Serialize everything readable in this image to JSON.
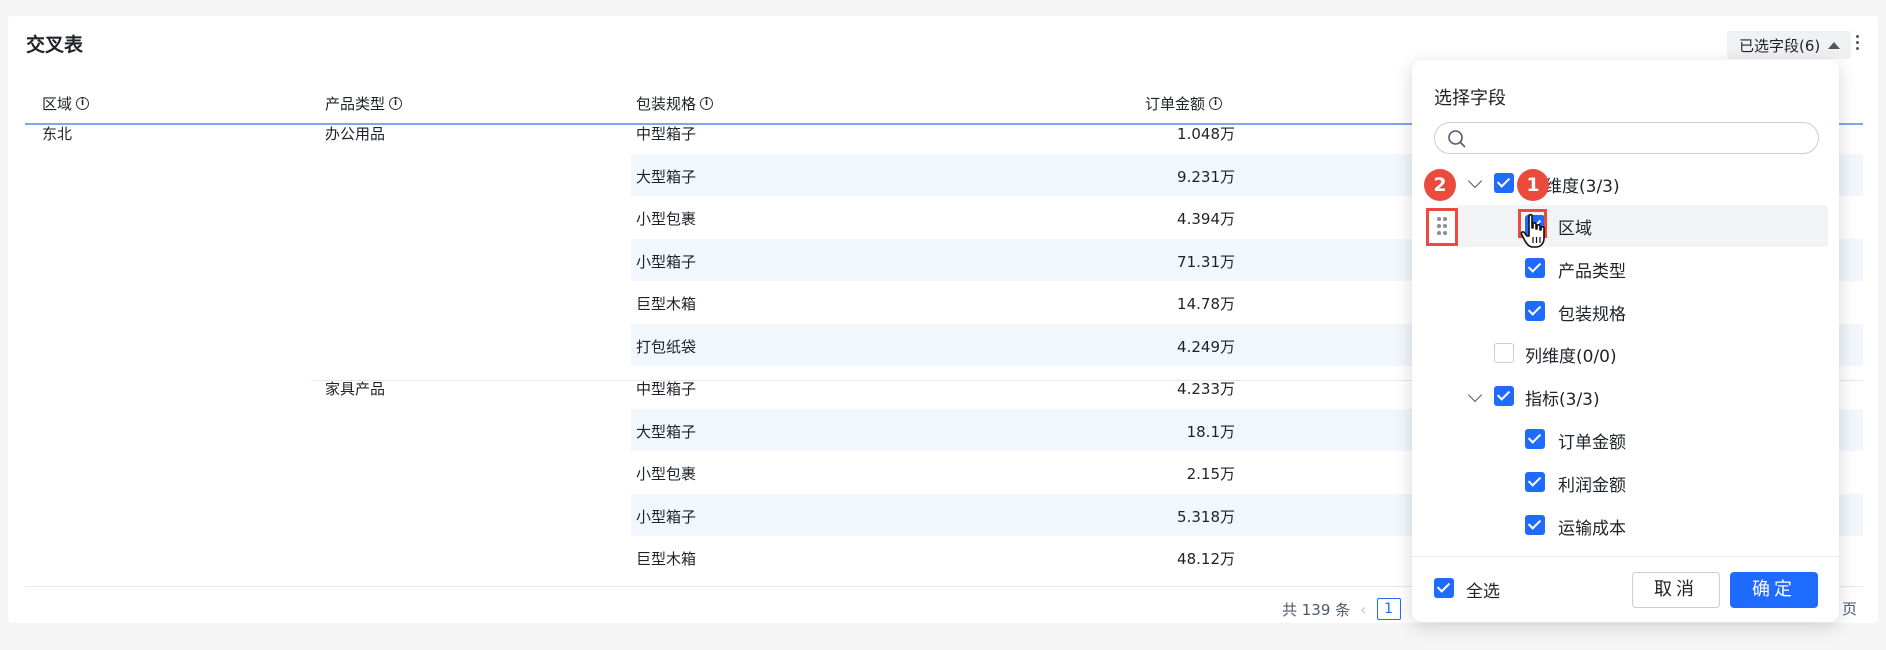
{
  "card": {
    "title": "交叉表",
    "field_toggle_label": "已选字段(6)"
  },
  "table": {
    "columns": [
      "区域",
      "产品类型",
      "包装规格",
      "订单金额"
    ],
    "rows": [
      {
        "region": "东北",
        "product": "办公用品",
        "pack": "中型箱子",
        "amount": "1.048万"
      },
      {
        "region": "",
        "product": "",
        "pack": "大型箱子",
        "amount": "9.231万"
      },
      {
        "region": "",
        "product": "",
        "pack": "小型包裹",
        "amount": "4.394万"
      },
      {
        "region": "",
        "product": "",
        "pack": "小型箱子",
        "amount": "71.31万"
      },
      {
        "region": "",
        "product": "",
        "pack": "巨型木箱",
        "amount": "14.78万"
      },
      {
        "region": "",
        "product": "",
        "pack": "打包纸袋",
        "amount": "4.249万"
      },
      {
        "region": "",
        "product": "家具产品",
        "pack": "中型箱子",
        "amount": "4.233万"
      },
      {
        "region": "",
        "product": "",
        "pack": "大型箱子",
        "amount": "18.1万"
      },
      {
        "region": "",
        "product": "",
        "pack": "小型包裹",
        "amount": "2.15万"
      },
      {
        "region": "",
        "product": "",
        "pack": "小型箱子",
        "amount": "5.318万"
      },
      {
        "region": "",
        "product": "",
        "pack": "巨型木箱",
        "amount": "48.12万"
      }
    ]
  },
  "pagination": {
    "total_text": "共 139 条",
    "current_page": "1",
    "tail_text": "页"
  },
  "popup": {
    "title": "选择字段",
    "search_placeholder": "",
    "tree": {
      "row_dim_label": "维度(3/3)",
      "row_dim_items": [
        "区域",
        "产品类型",
        "包装规格"
      ],
      "col_dim_label": "列维度(0/0)",
      "metric_label": "指标(3/3)",
      "metric_items": [
        "订单金额",
        "利润金额",
        "运输成本"
      ]
    },
    "select_all_label": "全选",
    "cancel_label": "取消",
    "ok_label": "确定"
  },
  "annotations": {
    "badge_1": "1",
    "badge_2": "2"
  },
  "colors": {
    "accent": "#1f6bff",
    "stripe": "#f2f6fd",
    "annotation_red": "#ea4b3c"
  }
}
